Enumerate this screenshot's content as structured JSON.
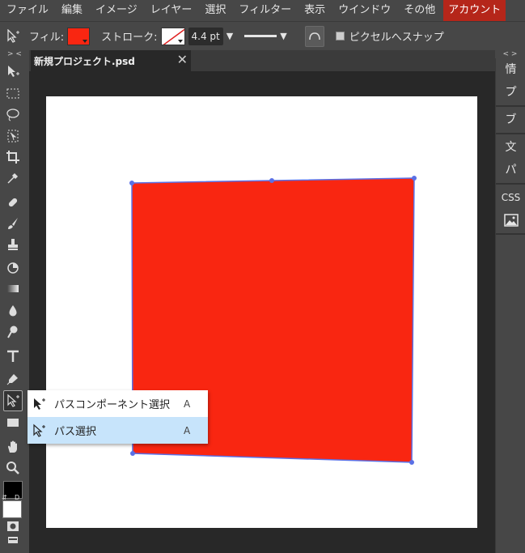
{
  "menubar": {
    "items": [
      "ファイル",
      "編集",
      "イメージ",
      "レイヤー",
      "選択",
      "フィルター",
      "表示",
      "ウインドウ",
      "その他"
    ],
    "account": "アカウント"
  },
  "options": {
    "fill_label": "フィル:",
    "fill_color": "#f92611",
    "stroke_label": "ストローク:",
    "stroke_width": "4.4 pt",
    "snap_label": "ピクセルへスナップ"
  },
  "toolbar": {
    "header": "> <",
    "swap": "⇵",
    "default": "D"
  },
  "tabs": {
    "doc_name": "新規プロジェクト.psd",
    "close": "✕"
  },
  "right_panel": {
    "header": "< >",
    "items": [
      "情",
      "プ",
      "ブ",
      "文",
      "パ",
      "CSS"
    ]
  },
  "flyout": {
    "items": [
      {
        "label": "パスコンポーネント選択",
        "shortcut": "A"
      },
      {
        "label": "パス選択",
        "shortcut": "A"
      }
    ]
  },
  "canvas": {
    "shape_color": "#f92611",
    "path_color": "#5a70e6"
  }
}
